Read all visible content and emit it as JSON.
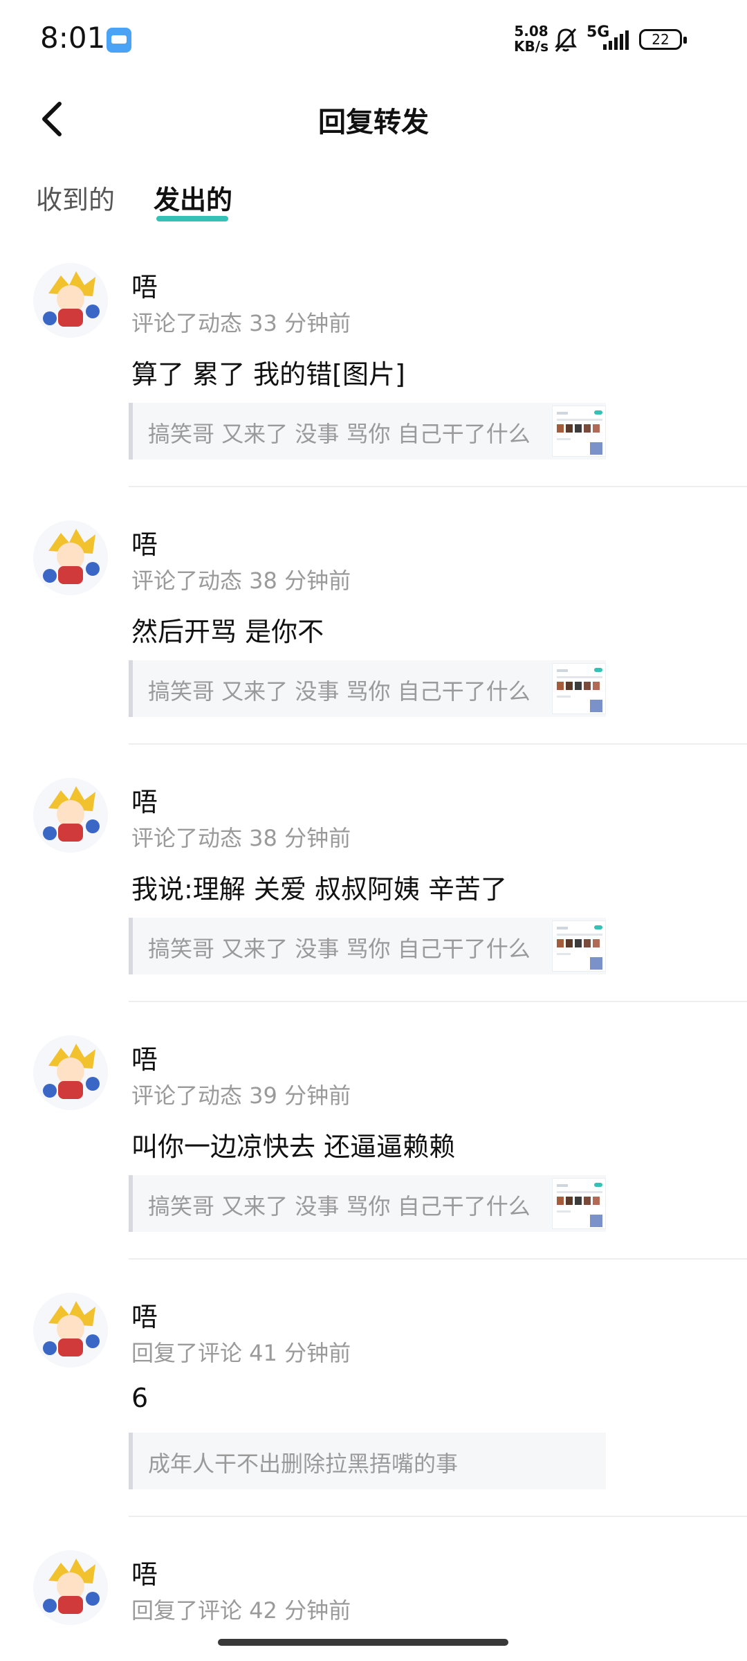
{
  "status_bar": {
    "time": "8:01",
    "net_speed_value": "5.08",
    "net_speed_unit": "KB/s",
    "network_label": "5G",
    "battery_level": "22"
  },
  "header": {
    "title": "回复转发"
  },
  "tabs": [
    {
      "label": "收到的",
      "selected": false
    },
    {
      "label": "发出的",
      "selected": true
    }
  ],
  "items": [
    {
      "username": "唔",
      "meta": "评论了动态 33 分钟前",
      "content": "算了 累了  我的错[图片]",
      "quote": "搞笑哥 又来了 没事 骂你 自己干了什么",
      "has_thumb": true
    },
    {
      "username": "唔",
      "meta": "评论了动态 38 分钟前",
      "content": "然后开骂 是你不",
      "quote": "搞笑哥 又来了 没事 骂你 自己干了什么",
      "has_thumb": true
    },
    {
      "username": "唔",
      "meta": "评论了动态 38 分钟前",
      "content": "我说:理解 关爱 叔叔阿姨 辛苦了",
      "quote": "搞笑哥 又来了 没事 骂你 自己干了什么",
      "has_thumb": true
    },
    {
      "username": "唔",
      "meta": "评论了动态 39 分钟前",
      "content": "叫你一边凉快去 还逼逼赖赖",
      "quote": "搞笑哥 又来了 没事 骂你 自己干了什么",
      "has_thumb": true
    },
    {
      "username": "唔",
      "meta": "回复了评论 41 分钟前",
      "content": "6",
      "quote": "成年人干不出删除拉黑捂嘴的事",
      "has_thumb": false
    },
    {
      "username": "唔",
      "meta": "回复了评论 42 分钟前",
      "content": "",
      "quote": "",
      "has_thumb": false
    }
  ],
  "colors": {
    "accent": "#35c1b6",
    "muted_text": "#9a9a9a",
    "quote_bg": "#f6f7f9"
  },
  "icons": [
    "back-icon",
    "bell-mute-icon",
    "signal-icon",
    "battery-icon",
    "app-notification-icon"
  ]
}
